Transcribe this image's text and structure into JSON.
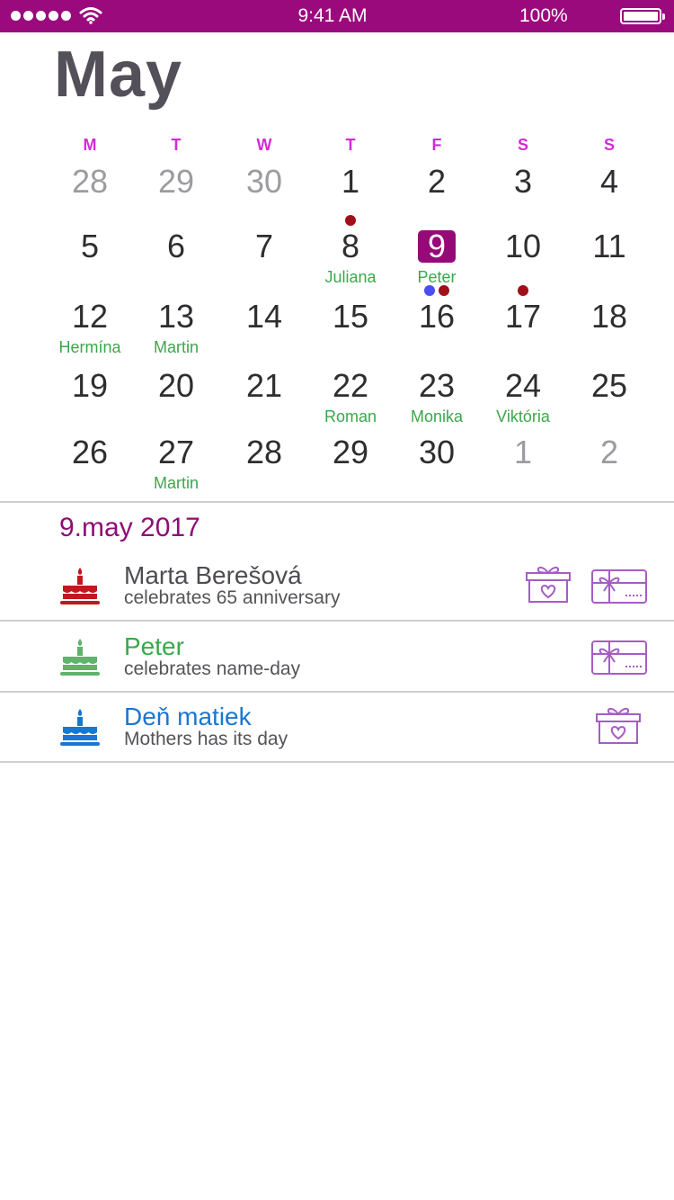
{
  "status_bar": {
    "time": "9:41 AM",
    "battery": "100%",
    "icons": [
      "signal-dots-icon",
      "wifi-icon",
      "battery-icon"
    ]
  },
  "calendar": {
    "month": "May",
    "weekdays": [
      "M",
      "T",
      "W",
      "T",
      "F",
      "S",
      "S"
    ],
    "weeks": [
      [
        {
          "day": "28",
          "muted": true
        },
        {
          "day": "29",
          "muted": true
        },
        {
          "day": "30",
          "muted": true
        },
        {
          "day": "1"
        },
        {
          "day": "2"
        },
        {
          "day": "3"
        },
        {
          "day": "4"
        }
      ],
      [
        {
          "day": "5"
        },
        {
          "day": "6"
        },
        {
          "day": "7"
        },
        {
          "day": "8",
          "name": "Juliana",
          "dots": [
            "#a0101a"
          ]
        },
        {
          "day": "9",
          "name": "Peter",
          "selected": true
        },
        {
          "day": "10"
        },
        {
          "day": "11"
        }
      ],
      [
        {
          "day": "12",
          "name": "Hermína"
        },
        {
          "day": "13",
          "name": "Martin"
        },
        {
          "day": "14"
        },
        {
          "day": "15"
        },
        {
          "day": "16",
          "dots": [
            "#4a4ef2",
            "#a0101a"
          ]
        },
        {
          "day": "17",
          "dots": [
            "#a0101a"
          ]
        },
        {
          "day": "18"
        }
      ],
      [
        {
          "day": "19"
        },
        {
          "day": "20"
        },
        {
          "day": "21"
        },
        {
          "day": "22",
          "name": "Roman"
        },
        {
          "day": "23",
          "name": "Monika"
        },
        {
          "day": "24",
          "name": "Viktória"
        },
        {
          "day": "25"
        }
      ],
      [
        {
          "day": "26"
        },
        {
          "day": "27",
          "name": "Martin"
        },
        {
          "day": "28"
        },
        {
          "day": "29"
        },
        {
          "day": "30"
        },
        {
          "day": "1",
          "muted": true
        },
        {
          "day": "2",
          "muted": true
        }
      ]
    ]
  },
  "selected_date": "9.may 2017",
  "events": [
    {
      "title": "Marta Berešová",
      "subtitle": "celebrates 65 anniversary",
      "title_color": "#4f4c51",
      "cake_color": "#c0181e",
      "actions": [
        "gift-box-icon",
        "gift-card-icon"
      ]
    },
    {
      "title": "Peter",
      "subtitle": "celebrates name-day",
      "title_color": "#3aa84a",
      "cake_color": "#5fb36a",
      "actions": [
        "gift-card-icon"
      ]
    },
    {
      "title": "Deň matiek",
      "subtitle": "Mothers has its day",
      "title_color": "#1877d2",
      "cake_color": "#1877d2",
      "actions": [
        "gift-box-icon"
      ]
    }
  ],
  "colors": {
    "brand": "#9b0a7d",
    "weekday": "#d12bd8",
    "name_day": "#3aa84a",
    "action_icon": "#a55dc4"
  }
}
